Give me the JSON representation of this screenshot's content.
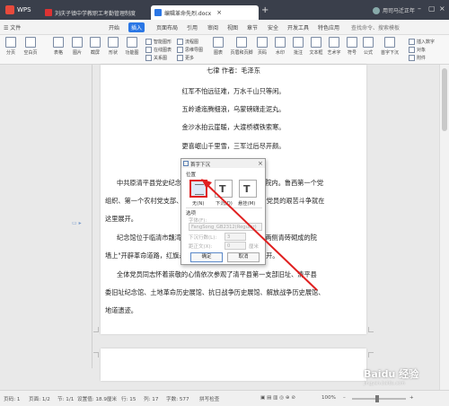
{
  "titlebar": {
    "app_name": "WPS",
    "tabs": [
      {
        "label": "刘庆子镇中学教职工考勤管理制度"
      },
      {
        "label": "编辑革命先烈.docx"
      }
    ],
    "user": "用司马迁正年"
  },
  "menubar": {
    "file_label": "☰ 文件",
    "items": [
      "开始",
      "插入",
      "页面布局",
      "引用",
      "审阅",
      "视图",
      "章节",
      "安全",
      "开发工具",
      "特色应用"
    ],
    "active": "插入",
    "search_placeholder": "查找命令、搜索模板",
    "right_items": [
      "未同步",
      "协作",
      "分享"
    ]
  },
  "ribbon": {
    "big_buttons": [
      "分页",
      "空白页",
      "表格",
      "图片",
      "截屏",
      "形状",
      "功能图",
      "图表",
      "页眉和页脚",
      "页码",
      "水印",
      "批注",
      "文本框",
      "艺术字",
      "符号",
      "公式",
      "首字下沉"
    ],
    "small_buttons": [
      "智能图形",
      "在线图表",
      "关系图",
      "流程图",
      "思维导图",
      "更多",
      "插入数字",
      "对象",
      "附件",
      "日期"
    ]
  },
  "document": {
    "poem": {
      "title": "七律  作者：毛泽东",
      "lines": [
        "红军不怕远征难，万水千山只等闲。",
        "五岭逶迤腾细浪，乌蒙磅礴走泥丸。",
        "金沙水拍云崖暖，大渡桥横铁索寒。",
        "更喜岷山千里雪，三军过后尽开颜。"
      ]
    },
    "para1": [
      "中共原清平县党史纪念馆，位于清平县党委机关旧址院内。鲁西第一个党",
      "组织、第一个农村党支部、第一次党代会在此召开，共产党员的艰苦斗争就在",
      "这里展开。"
    ],
    "para2": [
      "纪念馆位于临清市魏湾镇刘庆子村，紧靠刘庆子大门两侧青砖砌成的院",
      "墙上\"开辟革命道路，红旗永远飘扬\"标语，纪念馆共计展开。"
    ],
    "para3": [
      "全体党员同志怀着崇敬的心情依次参观了清平县第一支部旧址、清平县",
      "委旧址纪念馆、土地革命历史展馆、抗日战争历史展馆、解放战争历史展馆、",
      "地道遗迹。"
    ]
  },
  "dialog": {
    "title": "首字下沉",
    "position_label": "位置",
    "options": [
      {
        "label": "无(N)",
        "selected": true
      },
      {
        "label": "下沉(D)",
        "selected": false
      },
      {
        "label": "悬挂(M)",
        "selected": false
      }
    ],
    "options_section": "选项",
    "font_label": "字体(F):",
    "font_value": "FangSong_GB2312(Regular)",
    "lines_label": "下沉行数(L):",
    "lines_value": "3",
    "distance_label": "距正文(X):",
    "distance_value": "0",
    "distance_unit": "厘米",
    "ok_label": "确定",
    "cancel_label": "取消"
  },
  "statusbar": {
    "page": "页码: 1",
    "pages": "页面: 1/2",
    "section": "节: 1/1",
    "position": "设置值: 18.9厘米",
    "row": "行: 15",
    "col": "列: 17",
    "words": "字数: 577",
    "spellcheck": "拼写检查",
    "zoom": "100%"
  },
  "watermark": {
    "text": "Baidu 经验",
    "sub": "jingyan.baidu.com"
  },
  "colors": {
    "accent": "#2b77e5",
    "highlight": "#e02020",
    "titlebar": "#3a3f4b"
  }
}
